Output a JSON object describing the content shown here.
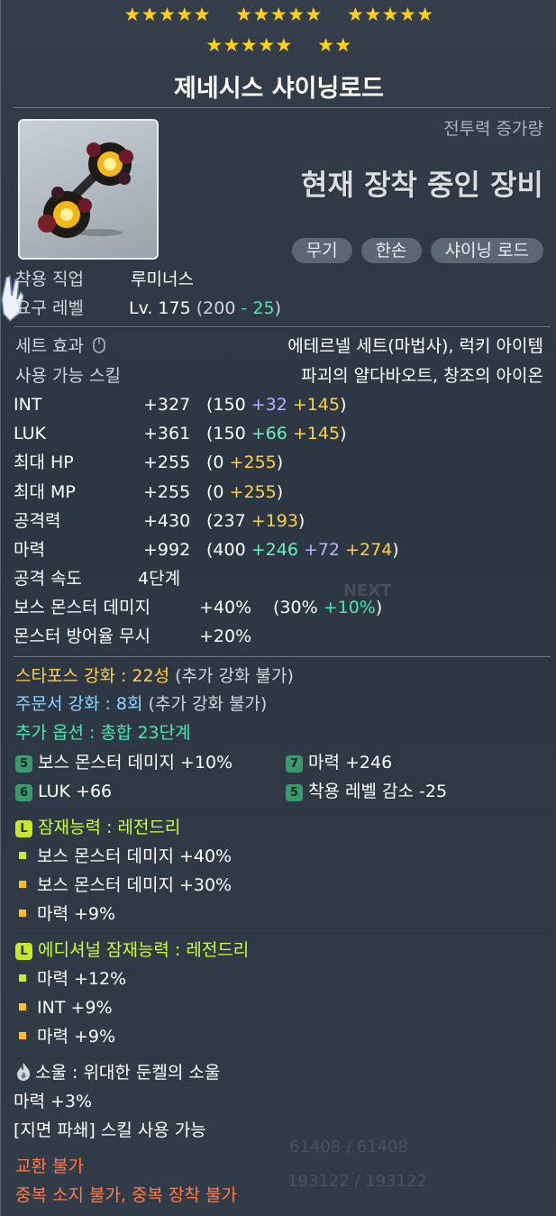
{
  "stars": {
    "row1": [
      "★★★★★",
      "★★★★★",
      "★★★★★"
    ],
    "row2": [
      "★★★★★",
      "★★"
    ]
  },
  "title": "제네시스 샤이닝로드",
  "header": {
    "combat_label": "전투력 증가량",
    "equipped_label": "현재 장착 중인 장비",
    "tags": [
      "무기",
      "한손",
      "샤이닝 로드"
    ]
  },
  "req": {
    "job_label": "착용 직업",
    "job_value": "루미너스",
    "level_label": "요구 레벨",
    "level_value": "Lv. 175",
    "level_open": "(200",
    "level_minus": " - 25",
    "level_close": ")"
  },
  "set": {
    "label": "세트 효과",
    "value": "에테르넬 세트(마법사), 럭키 아이템",
    "skill_label": "사용 가능 스킬",
    "skill_value": "파괴의 얄다바오트, 창조의 아이온"
  },
  "stats": [
    {
      "name": "INT",
      "value": "+327",
      "base": "(150",
      "parts": [
        {
          "t": " +32",
          "c": "purple"
        },
        {
          "t": " +145",
          "c": "gold"
        }
      ],
      "close": ")"
    },
    {
      "name": "LUK",
      "value": "+361",
      "base": "(150",
      "parts": [
        {
          "t": " +66",
          "c": "green"
        },
        {
          "t": " +145",
          "c": "gold"
        }
      ],
      "close": ")"
    },
    {
      "name": "최대 HP",
      "value": "+255",
      "base": "(0",
      "parts": [
        {
          "t": " +255",
          "c": "gold"
        }
      ],
      "close": ")"
    },
    {
      "name": "최대 MP",
      "value": "+255",
      "base": "(0",
      "parts": [
        {
          "t": " +255",
          "c": "gold"
        }
      ],
      "close": ")"
    },
    {
      "name": "공격력",
      "value": "+430",
      "base": "(237",
      "parts": [
        {
          "t": " +193",
          "c": "gold"
        }
      ],
      "close": ")"
    },
    {
      "name": "마력",
      "value": "+992",
      "base": "(400",
      "parts": [
        {
          "t": " +246",
          "c": "green"
        },
        {
          "t": " +72",
          "c": "purple"
        },
        {
          "t": " +274",
          "c": "gold"
        }
      ],
      "close": ")"
    }
  ],
  "extra_stats": {
    "attack_speed_label": "공격 속도",
    "attack_speed_value": "4단계",
    "boss_label": "보스 몬스터 데미지",
    "boss_value": "+40%",
    "boss_base": "(30%",
    "boss_plus": " +10%",
    "boss_close": ")",
    "ignore_label": "몬스터 방어율 무시",
    "ignore_value": "+20%"
  },
  "enhance": {
    "starforce": "스타포스 강화 : 22성",
    "starforce_note": "(추가 강화 불가)",
    "scroll": "주문서 강화 : 8회",
    "scroll_note": "(추가 강화 불가)",
    "addopt": "추가 옵션 : 총합 23단계"
  },
  "addopt_lines": [
    {
      "badge": "5",
      "text": "보스 몬스터 데미지  +10%"
    },
    {
      "badge": "7",
      "text": "마력  +246"
    },
    {
      "badge": "6",
      "text": "LUK  +66"
    },
    {
      "badge": "5",
      "text": "착용 레벨 감소  -25"
    }
  ],
  "potential": {
    "badge": "L",
    "title": "잠재능력 : 레전드리",
    "lines": [
      "보스 몬스터 데미지 +40%",
      "보스 몬스터 데미지 +30%",
      "마력 +9%"
    ]
  },
  "additional": {
    "badge": "L",
    "title": "에디셔널 잠재능력 : 레전드리",
    "lines": [
      "마력 +12%",
      "INT +9%",
      "마력 +9%"
    ]
  },
  "soul": {
    "title": "소울 : 위대한 둔켈의 소울",
    "effect": "마력 +3%",
    "skill": "[지면 파쇄] 스킬 사용 가능"
  },
  "footer": {
    "trade": "교환 불가",
    "unique": "중복 소지 불가, 중복 장착 불가"
  },
  "background_text": {
    "hp": "61408 / 61408",
    "mp": "193122 / 193122",
    "next": "NEXT"
  }
}
